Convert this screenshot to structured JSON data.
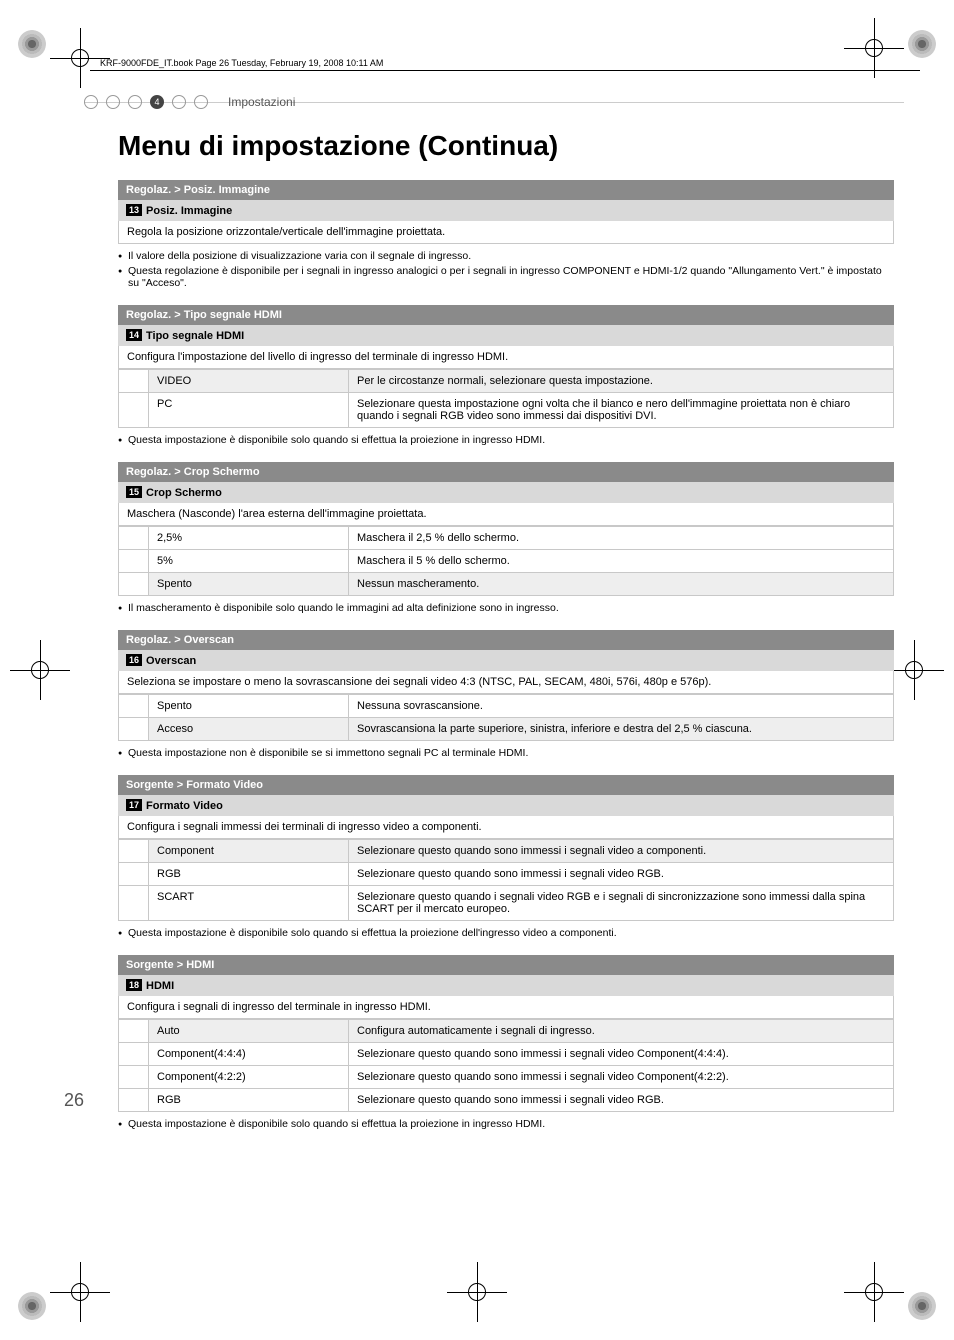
{
  "meta": {
    "bookline": "KRF-9000FDE_IT.book  Page 26  Tuesday, February 19, 2008  10:11 AM",
    "breadcrumb_chapter_num": "4",
    "breadcrumb_label": "Impostazioni",
    "page_num": "26"
  },
  "title": "Menu di impostazione (Continua)",
  "sections": [
    {
      "bar": "Regolaz. > Posiz. Immagine",
      "sub_num": "13",
      "sub_label": "Posiz. Immagine",
      "desc": "Regola la posizione orizzontale/verticale dell'immagine proiettata.",
      "rows": [],
      "notes": [
        "Il valore della posizione di visualizzazione varia con il segnale di ingresso.",
        "Questa regolazione è disponibile per i segnali in ingresso analogici o per i segnali in ingresso COMPONENT e HDMI-1/2 quando \"Allungamento Vert.\" è impostato su \"Acceso\"."
      ]
    },
    {
      "bar": "Regolaz. > Tipo segnale HDMI",
      "sub_num": "14",
      "sub_label": "Tipo segnale HDMI",
      "desc": "Configura l'impostazione del livello di ingresso del terminale di ingresso HDMI.",
      "rows": [
        {
          "k": "VIDEO",
          "v": "Per le circostanze normali, selezionare questa impostazione.",
          "shade": true
        },
        {
          "k": "PC",
          "v": "Selezionare questa impostazione ogni volta che il bianco e nero dell'immagine proiettata non è chiaro quando i segnali RGB video sono immessi dai dispositivi DVI."
        }
      ],
      "notes": [
        "Questa impostazione è disponibile solo quando si effettua la proiezione in ingresso HDMI."
      ]
    },
    {
      "bar": "Regolaz. > Crop Schermo",
      "sub_num": "15",
      "sub_label": "Crop Schermo",
      "desc": "Maschera (Nasconde) l'area esterna dell'immagine proiettata.",
      "rows": [
        {
          "k": "2,5%",
          "v": "Maschera il 2,5 % dello schermo."
        },
        {
          "k": "5%",
          "v": "Maschera il 5 % dello schermo."
        },
        {
          "k": "Spento",
          "v": "Nessun mascheramento.",
          "shade": true
        }
      ],
      "notes": [
        "Il mascheramento è disponibile solo quando le immagini ad alta definizione sono in ingresso."
      ]
    },
    {
      "bar": "Regolaz. > Overscan",
      "sub_num": "16",
      "sub_label": "Overscan",
      "desc": "Seleziona se impostare o meno la sovrascansione dei segnali video 4:3 (NTSC, PAL, SECAM, 480i, 576i, 480p e 576p).",
      "rows": [
        {
          "k": "Spento",
          "v": "Nessuna sovrascansione."
        },
        {
          "k": "Acceso",
          "v": "Sovrascansiona la parte superiore, sinistra, inferiore e destra del 2,5 % ciascuna.",
          "shade": true
        }
      ],
      "notes": [
        "Questa impostazione non è disponibile se si immettono segnali PC al terminale HDMI."
      ]
    },
    {
      "bar": "Sorgente > Formato Video",
      "sub_num": "17",
      "sub_label": "Formato Video",
      "desc": "Configura i segnali immessi dei terminali di ingresso video a componenti.",
      "rows": [
        {
          "k": "Component",
          "v": "Selezionare questo quando sono immessi i segnali video a componenti.",
          "shade": true
        },
        {
          "k": "RGB",
          "v": "Selezionare questo quando sono immessi i segnali video RGB."
        },
        {
          "k": "SCART",
          "v": "Selezionare questo quando i segnali video RGB e i segnali di sincronizzazione sono immessi dalla spina SCART per il mercato europeo."
        }
      ],
      "notes": [
        "Questa impostazione è disponibile solo quando si effettua la proiezione dell'ingresso video a componenti."
      ]
    },
    {
      "bar": "Sorgente > HDMI",
      "sub_num": "18",
      "sub_label": "HDMI",
      "desc": "Configura i segnali di ingresso del terminale in ingresso HDMI.",
      "rows": [
        {
          "k": "Auto",
          "v": "Configura automaticamente i segnali di ingresso.",
          "shade": true
        },
        {
          "k": "Component(4:4:4)",
          "v": "Selezionare questo quando sono immessi i segnali video Component(4:4:4)."
        },
        {
          "k": "Component(4:2:2)",
          "v": "Selezionare questo quando sono immessi i segnali video Component(4:2:2)."
        },
        {
          "k": "RGB",
          "v": "Selezionare questo quando sono immessi i segnali video RGB."
        }
      ],
      "notes": [
        "Questa impostazione è disponibile solo quando si effettua la proiezione in ingresso HDMI."
      ]
    }
  ]
}
